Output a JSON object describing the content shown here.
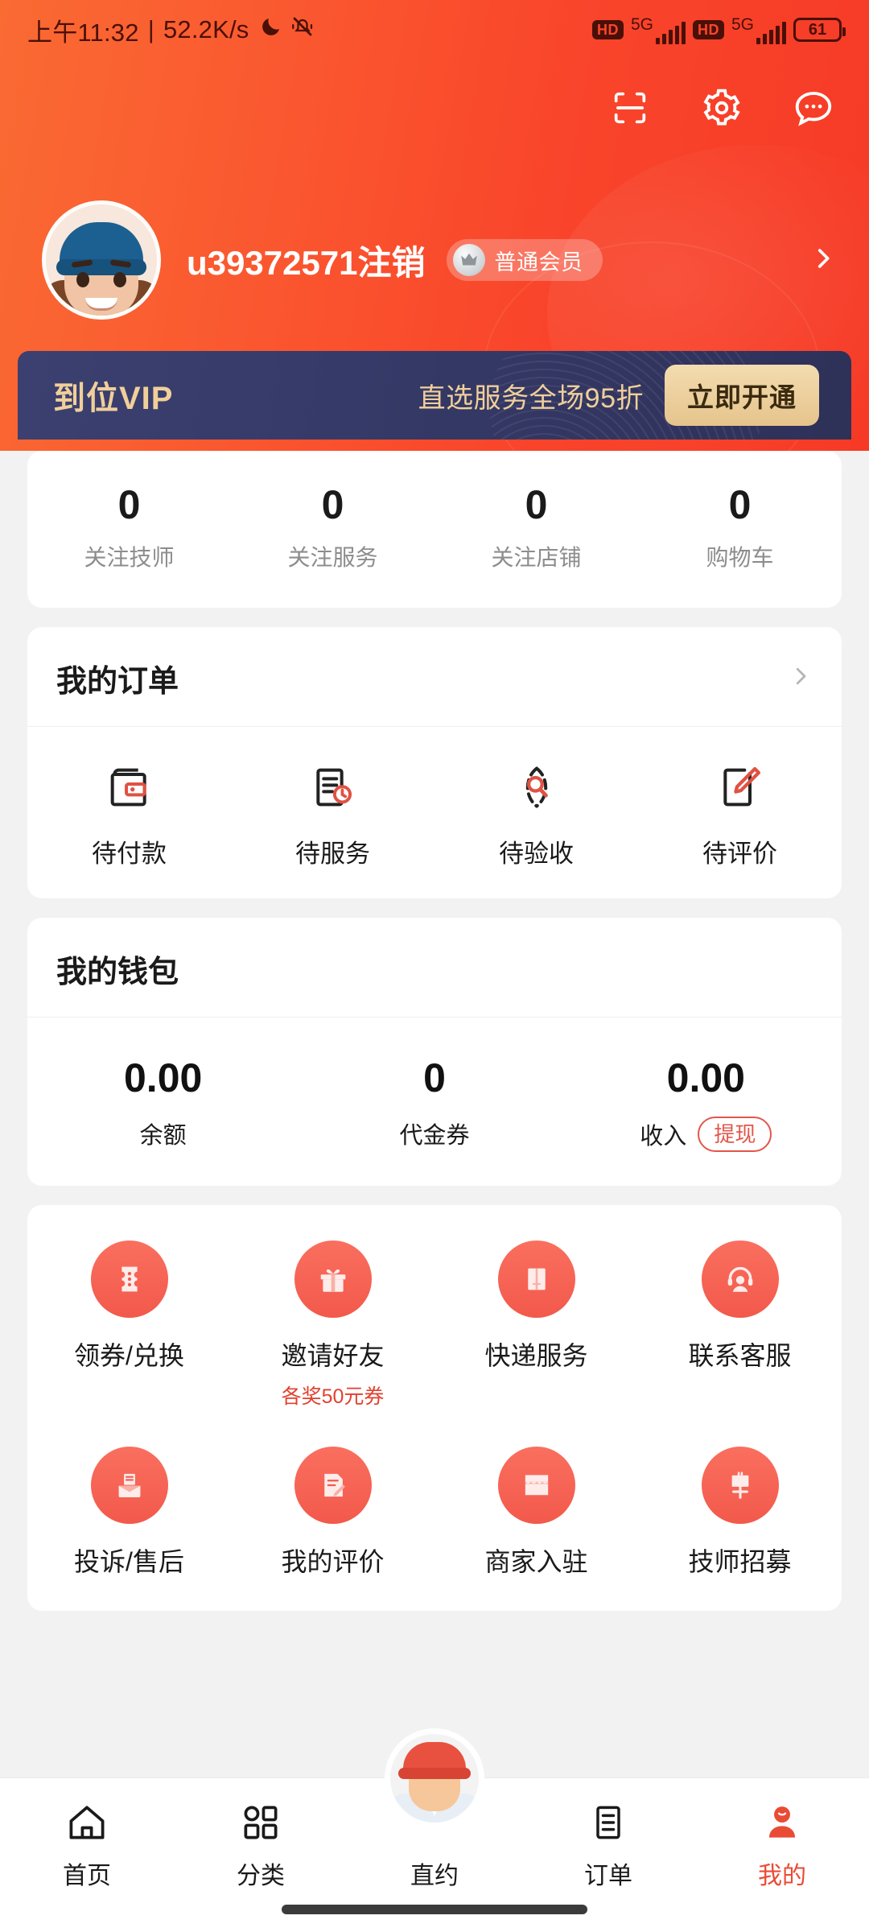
{
  "statusbar": {
    "time": "上午11:32",
    "separator": "|",
    "netspeed": "52.2K/s",
    "moon_icon": "moon-icon",
    "mute_icon": "bell-muted-icon",
    "hd_label_1": "HD",
    "net_label_1": "5G",
    "hd_label_2": "HD",
    "net_label_2": "5G",
    "battery_level": "61"
  },
  "header": {
    "scan_icon": "scan-icon",
    "settings_icon": "gear-icon",
    "message_icon": "chat-bubble-icon",
    "gradient_start": "#fa6a33",
    "gradient_end": "#f63a26",
    "profile": {
      "username": "u39372571注销",
      "member_badge": "普通会员",
      "crown_icon": "crown-icon",
      "chevron_icon": "chevron-right-icon"
    },
    "vip_banner": {
      "title": "到位VIP",
      "description": "直选服务全场95折",
      "button": "立即开通",
      "bg_color": "#363a68",
      "gold_color": "#f0cf9a"
    }
  },
  "stats": [
    {
      "value": "0",
      "label": "关注技师"
    },
    {
      "value": "0",
      "label": "关注服务"
    },
    {
      "value": "0",
      "label": "关注店铺"
    },
    {
      "value": "0",
      "label": "购物车"
    }
  ],
  "orders": {
    "title": "我的订单",
    "chevron_icon": "chevron-right-icon",
    "items": [
      {
        "label": "待付款",
        "icon": "wallet-icon"
      },
      {
        "label": "待服务",
        "icon": "document-clock-icon"
      },
      {
        "label": "待验收",
        "icon": "search-inspect-icon"
      },
      {
        "label": "待评价",
        "icon": "edit-pencil-icon"
      }
    ]
  },
  "wallet": {
    "title": "我的钱包",
    "cells": [
      {
        "value": "0.00",
        "label": "余额"
      },
      {
        "value": "0",
        "label": "代金券"
      },
      {
        "value": "0.00",
        "label": "收入"
      }
    ],
    "withdraw_button": "提现",
    "accent_color": "#e2564b"
  },
  "grid": {
    "row1": [
      {
        "label": "领券/兑换",
        "sub": "",
        "icon": "coupon-ticket-icon"
      },
      {
        "label": "邀请好友",
        "sub": "各奖50元券",
        "icon": "gift-icon"
      },
      {
        "label": "快递服务",
        "sub": "",
        "icon": "package-box-icon"
      },
      {
        "label": "联系客服",
        "sub": "",
        "icon": "headset-support-icon"
      }
    ],
    "row2": [
      {
        "label": "投诉/售后",
        "sub": "",
        "icon": "complaint-inbox-icon"
      },
      {
        "label": "我的评价",
        "sub": "",
        "icon": "review-pencil-icon"
      },
      {
        "label": "商家入驻",
        "sub": "",
        "icon": "shop-store-icon"
      },
      {
        "label": "技师招募",
        "sub": "",
        "icon": "recruit-banner-icon"
      }
    ]
  },
  "navbar": {
    "items": [
      {
        "label": "首页",
        "icon": "home-icon",
        "active": false
      },
      {
        "label": "分类",
        "icon": "category-grid-icon",
        "active": false
      },
      {
        "label": "直约",
        "icon": "technician-avatar-icon",
        "active": false
      },
      {
        "label": "订单",
        "icon": "order-list-icon",
        "active": false
      },
      {
        "label": "我的",
        "icon": "profile-person-icon",
        "active": true
      }
    ],
    "active_color": "#ea4b35"
  }
}
